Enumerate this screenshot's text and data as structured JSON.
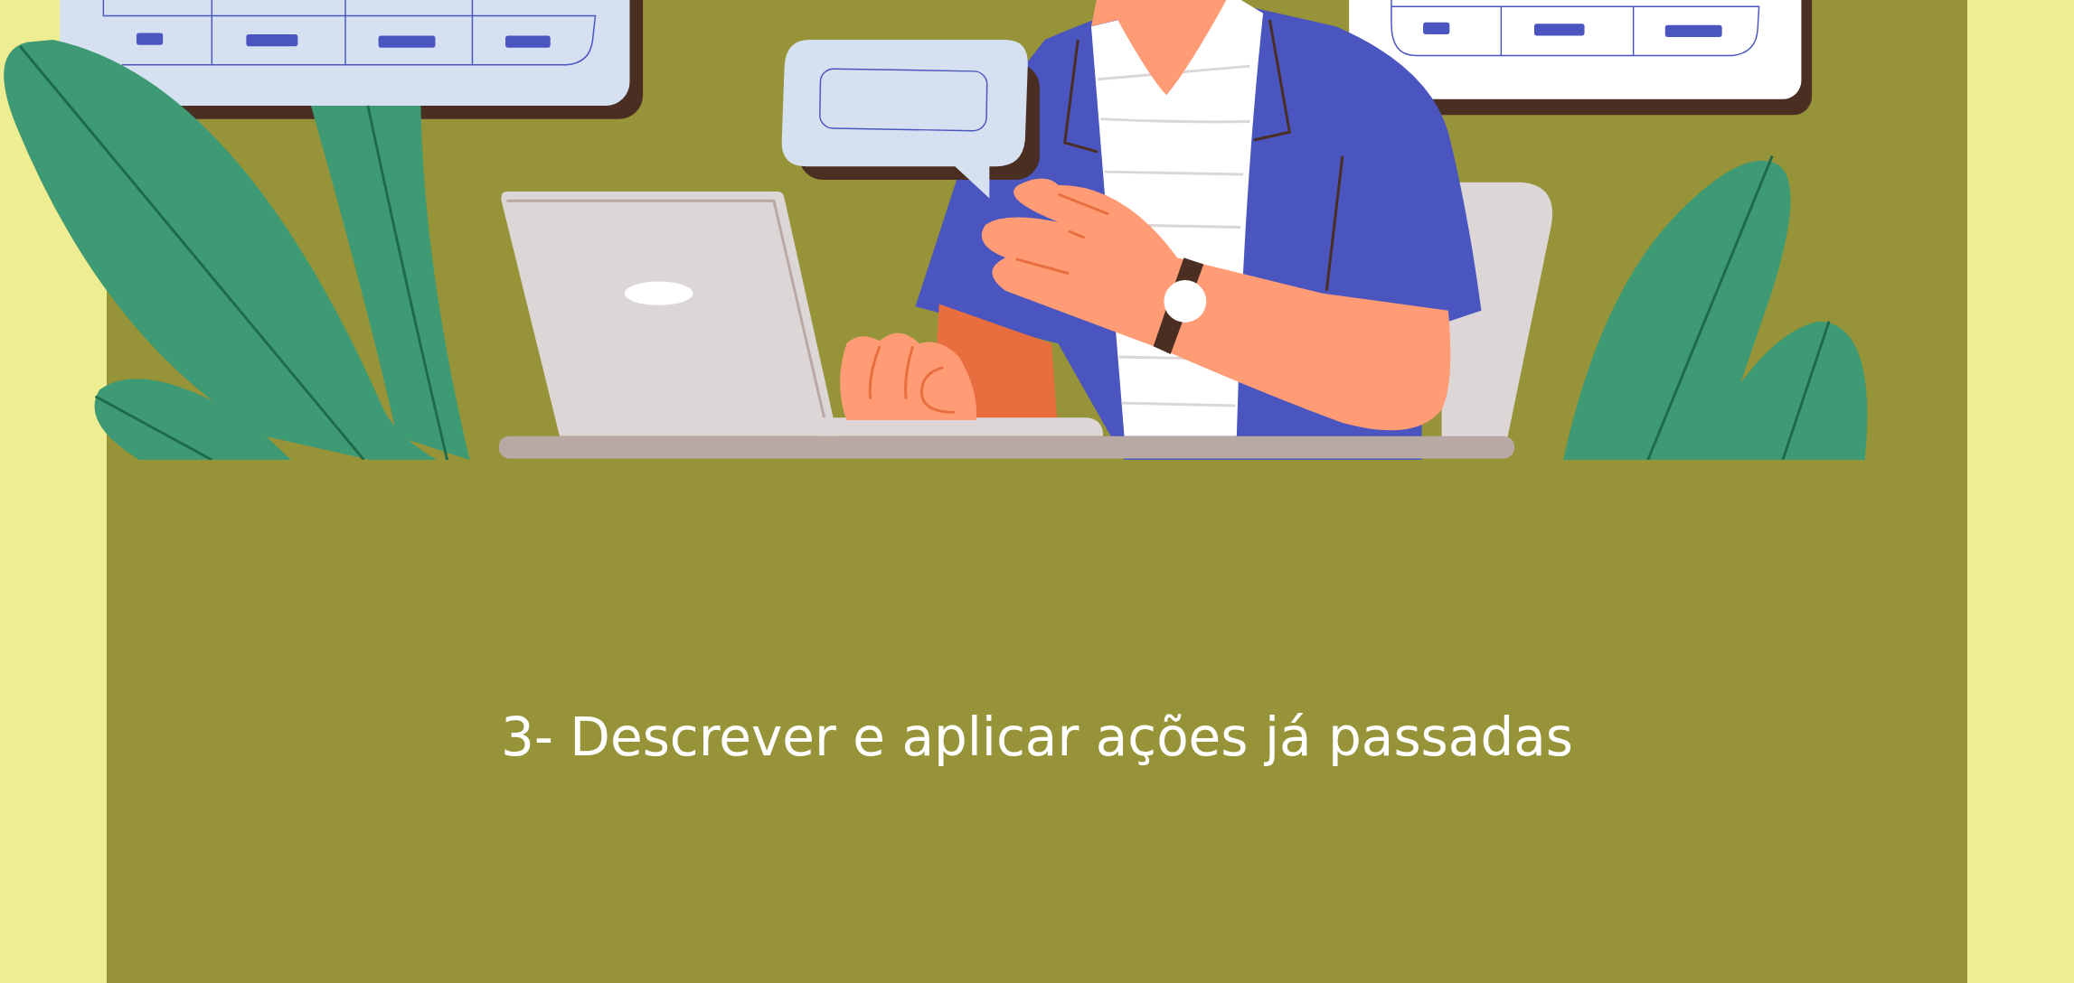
{
  "heading": "3- Descrever e aplicar ações já passadas"
}
